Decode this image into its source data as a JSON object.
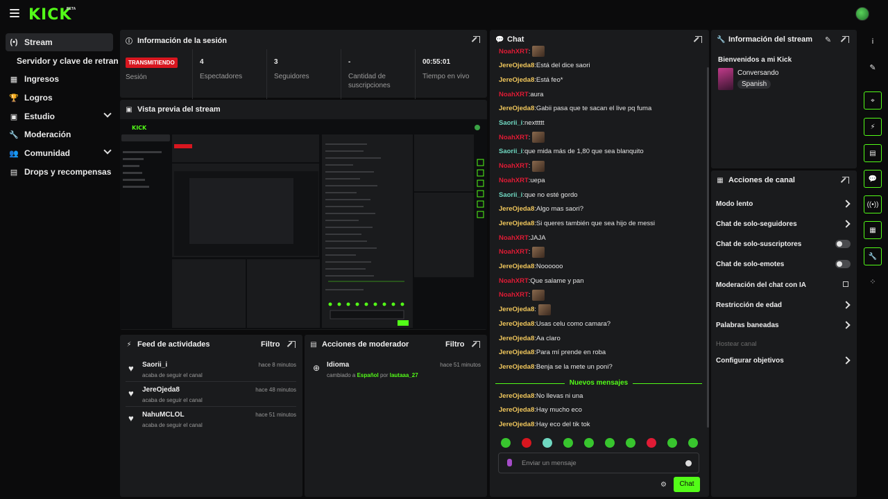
{
  "app": {
    "logo": "KICK",
    "logo_badge": "BETA"
  },
  "sidebar": {
    "items": [
      {
        "label": "Stream",
        "icon": "broadcast-icon",
        "glyph": "(•)",
        "active": true
      },
      {
        "label": "Servidor y clave de retransm",
        "sub": true
      },
      {
        "label": "Ingresos",
        "icon": "chart-icon",
        "glyph": "▦"
      },
      {
        "label": "Logros",
        "icon": "trophy-icon",
        "glyph": "🏆"
      },
      {
        "label": "Estudio",
        "icon": "layout-icon",
        "glyph": "▣",
        "chevron": true
      },
      {
        "label": "Moderación",
        "icon": "wrench-icon",
        "glyph": "🔧"
      },
      {
        "label": "Comunidad",
        "icon": "users-icon",
        "glyph": "👥",
        "chevron": true
      },
      {
        "label": "Drops y recompensas",
        "icon": "gift-icon",
        "glyph": "▤"
      }
    ]
  },
  "session": {
    "title": "Información de la sesión",
    "live_badge": "TRANSMITIENDO",
    "live_label": "Sesión",
    "stats": [
      {
        "value": "4",
        "label": "Espectadores"
      },
      {
        "value": "3",
        "label": "Seguidores"
      },
      {
        "value": "-",
        "label": "Cantidad de suscripciones"
      },
      {
        "value": "00:55:01",
        "label": "Tiempo en vivo"
      }
    ]
  },
  "preview": {
    "title": "Vista previa del stream"
  },
  "activity": {
    "title": "Feed de actividades",
    "filter": "Filtro",
    "items": [
      {
        "name": "Saorii_i",
        "desc": "acaba de seguir el canal",
        "time": "hace 8 minutos"
      },
      {
        "name": "JereOjeda8",
        "desc": "acaba de seguir el canal",
        "time": "hace 48 minutos"
      },
      {
        "name": "NahuMCLOL",
        "desc": "acaba de seguir el canal",
        "time": "hace 51 minutos"
      }
    ]
  },
  "mod_actions": {
    "title": "Acciones de moderador",
    "filter": "Filtro",
    "items": [
      {
        "name": "Idioma",
        "desc_pre": "cambiado a ",
        "desc_val": "Español",
        "desc_mid": " por ",
        "desc_user": "lautaaa_27",
        "time": "hace 51 minutos"
      }
    ]
  },
  "chat": {
    "title": "Chat",
    "messages": [
      {
        "user": "NoahXRT",
        "color": "red",
        "text": "",
        "emote": true
      },
      {
        "user": "JereOjeda8",
        "color": "yellow",
        "text": "Está del dice saori"
      },
      {
        "user": "JereOjeda8",
        "color": "yellow",
        "text": "Está feo*"
      },
      {
        "user": "NoahXRT",
        "color": "red",
        "text": "aura"
      },
      {
        "user": "JereOjeda8",
        "color": "yellow",
        "text": "Gabii pasa que te sacan el live pq fuma"
      },
      {
        "user": "Saorii_i",
        "color": "teal",
        "text": "nexttttt"
      },
      {
        "user": "NoahXRT",
        "color": "red",
        "text": "",
        "emote": true
      },
      {
        "user": "Saorii_i",
        "color": "teal",
        "text": "que mida más de 1,80 que sea blanquito"
      },
      {
        "user": "NoahXRT",
        "color": "red",
        "text": "",
        "emote": true
      },
      {
        "user": "NoahXRT",
        "color": "red",
        "text": "uepa"
      },
      {
        "user": "Saorii_i",
        "color": "teal",
        "text": "que no esté gordo"
      },
      {
        "user": "JereOjeda8",
        "color": "yellow",
        "text": "Algo mas saori?"
      },
      {
        "user": "JereOjeda8",
        "color": "yellow",
        "text": "Si queres también que sea hijo de messi"
      },
      {
        "user": "NoahXRT",
        "color": "red",
        "text": "JAJA"
      },
      {
        "user": "NoahXRT",
        "color": "red",
        "text": "",
        "emote": true
      },
      {
        "user": "JereOjeda8",
        "color": "yellow",
        "text": "Noooooo"
      },
      {
        "user": "NoahXRT",
        "color": "red",
        "text": "Que salame y pan"
      },
      {
        "user": "NoahXRT",
        "color": "red",
        "text": "",
        "emote": true
      },
      {
        "user": "JereOjeda8",
        "color": "yellow",
        "text": "",
        "emote": true
      },
      {
        "user": "JereOjeda8",
        "color": "yellow",
        "text": "Usas celu como camara?"
      },
      {
        "user": "JereOjeda8",
        "color": "yellow",
        "text": "Aa claro"
      },
      {
        "user": "JereOjeda8",
        "color": "yellow",
        "text": "Para mí prende en roba"
      },
      {
        "user": "JereOjeda8",
        "color": "yellow",
        "text": "Benja se la mete un poni?"
      }
    ],
    "divider": "Nuevos mensajes",
    "new_messages": [
      {
        "user": "JereOjeda8",
        "color": "yellow",
        "text": "No llevas ni una"
      },
      {
        "user": "JereOjeda8",
        "color": "yellow",
        "text": "Hay mucho eco"
      },
      {
        "user": "JereOjeda8",
        "color": "yellow",
        "text": "Hay eco del tik tok"
      }
    ],
    "input_placeholder": "Enviar un mensaje",
    "send_label": "Chat"
  },
  "stream_info": {
    "title": "Información del stream",
    "stream_title": "Bienvenidos a mi Kick",
    "category": "Conversando",
    "language": "Spanish"
  },
  "channel_actions": {
    "title": "Acciones de canal",
    "items": [
      {
        "label": "Modo lento",
        "kind": "chevron"
      },
      {
        "label": "Chat de solo-seguidores",
        "kind": "chevron"
      },
      {
        "label": "Chat de solo-suscriptores",
        "kind": "toggle"
      },
      {
        "label": "Chat de solo-emotes",
        "kind": "toggle"
      },
      {
        "label": "Moderación del chat con IA",
        "kind": "external"
      },
      {
        "label": "Restricción de edad",
        "kind": "chevron"
      },
      {
        "label": "Palabras baneadas",
        "kind": "chevron"
      },
      {
        "label": "Hostear canal",
        "kind": "disabled"
      },
      {
        "label": "Configurar objetivos",
        "kind": "chevron"
      }
    ]
  },
  "rail": {
    "items": [
      {
        "icon": "info-icon",
        "glyph": "i",
        "style": "plain"
      },
      {
        "icon": "pencil-icon",
        "glyph": "✎",
        "style": "plain"
      },
      {
        "icon": "target-icon",
        "glyph": "⌖",
        "style": "green"
      },
      {
        "icon": "bolt-icon",
        "glyph": "⚡",
        "style": "green"
      },
      {
        "icon": "document-icon",
        "glyph": "▤",
        "style": "green"
      },
      {
        "icon": "chat-bubble-icon",
        "glyph": "💬",
        "style": "green"
      },
      {
        "icon": "broadcast-icon",
        "glyph": "((•))",
        "style": "green"
      },
      {
        "icon": "panel-icon",
        "glyph": "▦",
        "style": "green"
      },
      {
        "icon": "wrench-icon",
        "glyph": "🔧",
        "style": "green"
      },
      {
        "icon": "dots-icon",
        "glyph": "⁘",
        "style": "plain"
      }
    ]
  },
  "colors": {
    "accent": "#53fc18",
    "live": "#d8161f",
    "user_red": "#e01b35",
    "user_yellow": "#f1c75c",
    "user_teal": "#6fd7c0"
  }
}
